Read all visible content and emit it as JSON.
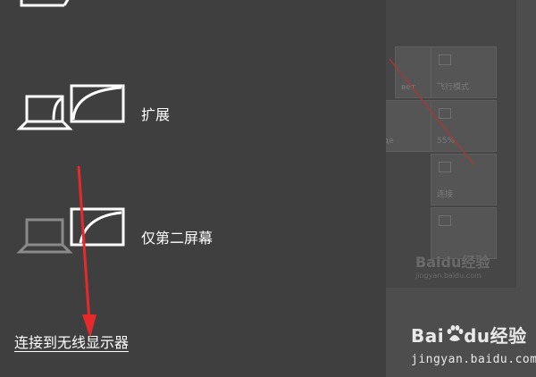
{
  "projection": {
    "options": [
      {
        "label": "扩展"
      },
      {
        "label": "仅第二屏幕"
      }
    ],
    "wireless_link": "连接到无线显示器"
  },
  "background_panel": {
    "tiles": [
      {
        "label": "вет"
      },
      {
        "label": "飞行模式"
      },
      {
        "label": "де"
      },
      {
        "label": "55%"
      },
      {
        "label": "连接"
      }
    ]
  },
  "watermark": {
    "brand_left": "Bai",
    "brand_du": "du",
    "brand_right": "经验",
    "url": "jingyan.baidu.com"
  },
  "colors": {
    "panel": "#3f3f3f",
    "text": "#ffffff",
    "arrow": "#e8292c",
    "icon_active": "#ffffff",
    "icon_dim": "#8a8a8a"
  }
}
